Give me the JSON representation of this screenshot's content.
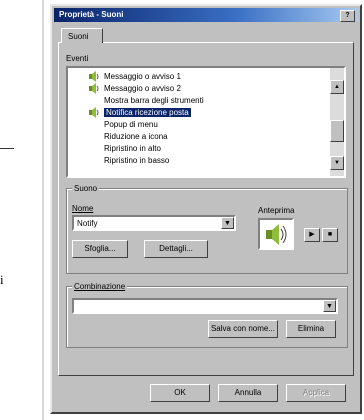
{
  "window": {
    "title": "Proprietà - Suoni",
    "help_label": "?"
  },
  "tabs": [
    {
      "label": "Suoni"
    }
  ],
  "events": {
    "label": "Eventi",
    "items": [
      {
        "label": "Messaggio o avviso 1",
        "icon": "speaker-icon",
        "selected": false
      },
      {
        "label": "Messaggio o avviso 2",
        "icon": "speaker-icon",
        "selected": false
      },
      {
        "label": "Mostra barra degli strumenti",
        "icon": "",
        "selected": false
      },
      {
        "label": "Notifica ricezione posta",
        "icon": "speaker-icon",
        "selected": true
      },
      {
        "label": "Popup di menu",
        "icon": "",
        "selected": false
      },
      {
        "label": "Riduzione a icona",
        "icon": "",
        "selected": false
      },
      {
        "label": "Ripristino in alto",
        "icon": "",
        "selected": false
      },
      {
        "label": "Ripristino in basso",
        "icon": "",
        "selected": false
      }
    ]
  },
  "sound": {
    "group_label": "Suono",
    "name_label": "Nome",
    "name_value": "Notify",
    "browse_label": "Sfoglia...",
    "details_label": "Dettagli...",
    "preview_label": "Anteprima",
    "play_symbol": "▶",
    "stop_symbol": "■"
  },
  "schemes": {
    "group_label": "Combinazione",
    "value": "",
    "save_as_label": "Salva con nome...",
    "delete_label": "Elimina"
  },
  "footer": {
    "ok_label": "OK",
    "cancel_label": "Annulla",
    "apply_label": "Applica"
  },
  "stray_text": "i",
  "colors": {
    "title_start": "#0a246a",
    "title_end": "#a6caf0",
    "face": "#c0c0c0",
    "selection": "#0a246a"
  }
}
